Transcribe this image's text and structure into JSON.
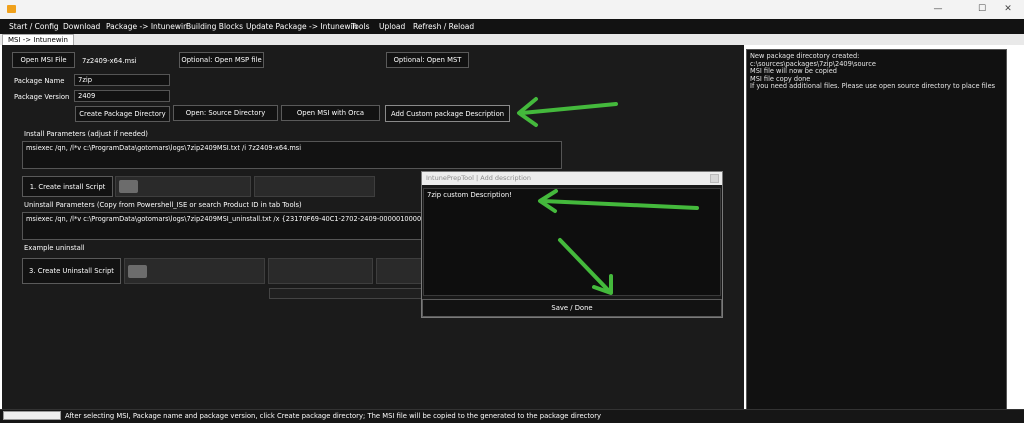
{
  "window": {
    "minimize_glyph": "—",
    "maximize_glyph": "☐",
    "close_glyph": "✕"
  },
  "menu": [
    {
      "label": "Start / Config"
    },
    {
      "label": "Download"
    },
    {
      "label": "Package -> Intunewin"
    },
    {
      "label": "Building Blocks"
    },
    {
      "label": "Update Package -> Intunewin"
    },
    {
      "label": "Tools"
    },
    {
      "label": "Upload"
    },
    {
      "label": "Refresh / Reload"
    }
  ],
  "tabs": [
    {
      "label": "MSI -> Intunewin"
    }
  ],
  "msi": {
    "open_msi_label": "Open MSI File",
    "msi_file_value": "7z2409-x64.msi",
    "open_msp_label": "Optional: Open MSP file",
    "open_mst_label": "Optional: Open MST",
    "package_name_label": "Package Name",
    "package_name_value": "7zip",
    "package_version_label": "Package Version",
    "package_version_value": "2409"
  },
  "actions": {
    "create_dir": "Create Package Directory",
    "open_source": "Open: Source Directory",
    "open_orca": "Open MSI with Orca",
    "add_desc": "Add Custom package Description"
  },
  "install": {
    "label": "Install Parameters (adjust if needed)",
    "value": "msiexec /qn, /l*v c:\\ProgramData\\gotomars\\logs\\7zip2409MSI.txt /i 7z2409-x64.msi",
    "create_script": "1. Create install Script"
  },
  "uninstall": {
    "label": "Uninstall Parameters (Copy from Powershell_ISE or search Product ID in tab Tools)",
    "value": "msiexec /qn, /l*v c:\\ProgramData\\gotomars\\logs\\7zip2409MSI_uninstall.txt /x {23170F69-40C1-2702-2409-000001000000}",
    "example_label": "Example uninstall",
    "create_script": "3. Create Uninstall Script"
  },
  "dialog": {
    "title": "IntunePrepTool | Add description",
    "text": "7zip custom Description!",
    "save_label": "Save / Done"
  },
  "log": [
    "New package direcotory created:",
    "c:\\sources\\packages\\7zip\\2409\\source",
    "MSI file will now be copied",
    "MSI file copy done",
    "If you need additional files. Please use open source directory to place files"
  ],
  "status": {
    "text": "After selecting MSI, Package name and package version, click Create package directory; The MSI file will be copied to the generated to the package directory"
  },
  "colors": {
    "accent_arrow": "#44b93c",
    "app_icon": "#f0a11c",
    "background": "#1b1b1b"
  }
}
